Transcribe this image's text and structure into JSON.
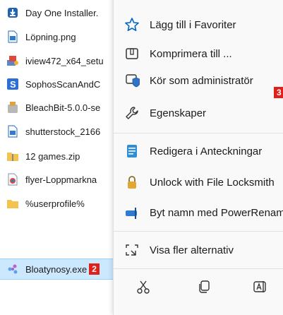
{
  "files": [
    {
      "name": "Day One Installer.",
      "icon": "download-icon"
    },
    {
      "name": "Löpning.png",
      "icon": "image-file-icon"
    },
    {
      "name": "iview472_x64_setu",
      "icon": "installer-icon"
    },
    {
      "name": "SophosScanAndC",
      "icon": "sophos-icon"
    },
    {
      "name": "BleachBit-5.0.0-se",
      "icon": "bleachbit-icon"
    },
    {
      "name": "shutterstock_2166",
      "icon": "image-file-icon"
    },
    {
      "name": "12 games.zip",
      "icon": "zip-folder-icon"
    },
    {
      "name": "flyer-Loppmarkna",
      "icon": "browser-file-icon"
    },
    {
      "name": "%userprofile%",
      "icon": "folder-icon"
    },
    {
      "name": "Bloatynosy.exe",
      "icon": "app-icon",
      "badge": "2"
    }
  ],
  "menu": {
    "items": [
      {
        "label": "Lägg till i Favoriter",
        "icon": "star-icon"
      },
      {
        "label": "Komprimera till ...",
        "icon": "zip-icon"
      },
      {
        "label": "Kör som administratör",
        "icon": "shield-icon"
      },
      {
        "label": "Egenskaper",
        "icon": "wrench-icon"
      },
      {
        "label": "Redigera i Anteckningar",
        "icon": "notepad-icon"
      },
      {
        "label": "Unlock with File Locksmith",
        "icon": "lock-icon"
      },
      {
        "label": "Byt namn med PowerRename",
        "icon": "rename-icon"
      },
      {
        "label": "Visa fler alternativ",
        "icon": "more-options-icon"
      }
    ],
    "marker": "3",
    "bottom_icons": [
      "cut-icon",
      "copy-icon",
      "rename-text-icon"
    ]
  },
  "colors": {
    "accent": "#0067c0",
    "badge": "#e0201b",
    "selection": "#cce8ff"
  }
}
